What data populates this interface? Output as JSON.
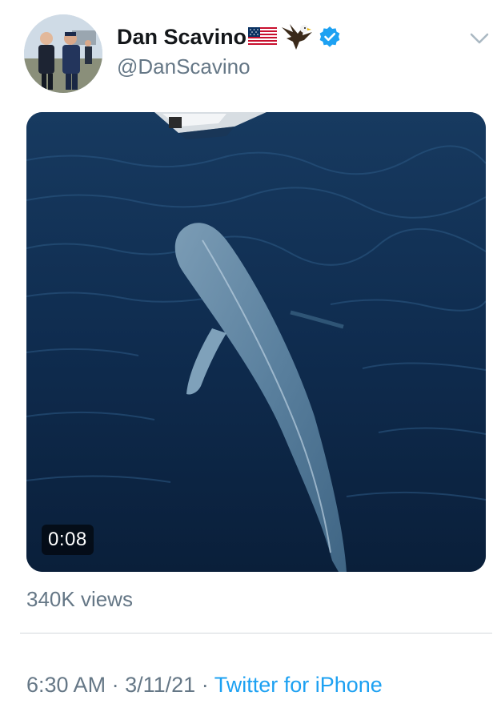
{
  "tweet": {
    "author": {
      "display_name": "Dan Scavino",
      "handle": "@DanScavino",
      "emoji": [
        "us-flag",
        "eagle"
      ],
      "verified": true
    },
    "media": {
      "type": "video",
      "duration": "0:08"
    },
    "views": "340K views",
    "meta": {
      "time": "6:30 AM",
      "separator": "·",
      "date": "3/11/21",
      "source": "Twitter for iPhone"
    }
  },
  "colors": {
    "text_primary": "#14171a",
    "text_secondary": "#657786",
    "link": "#1da1f2",
    "verified_badge": "#1da1f2",
    "divider": "#d3d8dc"
  },
  "icons": [
    "chevron-down-icon",
    "verified-icon",
    "flag-icon",
    "eagle-icon"
  ]
}
